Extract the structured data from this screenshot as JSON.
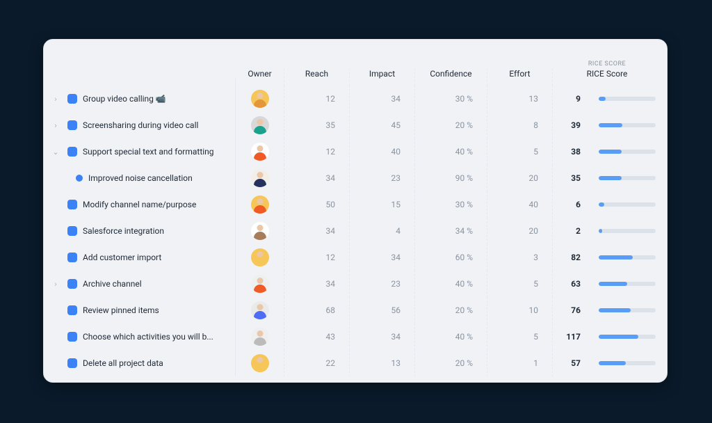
{
  "columns": {
    "score_pretitle": "RICE SCORE",
    "owner": "Owner",
    "reach": "Reach",
    "impact": "Impact",
    "confidence": "Confidence",
    "effort": "Effort",
    "score": "RICE Score"
  },
  "rows": [
    {
      "chevron": "right",
      "marker": "square",
      "title": "Group video calling 📹",
      "avatar": {
        "bg": "#f6c758",
        "accent": "#e4973a"
      },
      "reach": "12",
      "impact": "34",
      "confidence": "30 %",
      "effort": "13",
      "score": "9",
      "bar": 12
    },
    {
      "chevron": "right",
      "marker": "square",
      "title": "Screensharing during video call",
      "avatar": {
        "bg": "#d8d8d8",
        "accent": "#19a38f"
      },
      "reach": "35",
      "impact": "45",
      "confidence": "20 %",
      "effort": "8",
      "score": "39",
      "bar": 42
    },
    {
      "chevron": "down",
      "marker": "square",
      "title": "Support special text and formatting",
      "avatar": {
        "bg": "#ffffff",
        "accent": "#f05a24"
      },
      "reach": "12",
      "impact": "40",
      "confidence": "40 %",
      "effort": "5",
      "score": "38",
      "bar": 40
    },
    {
      "chevron": "none",
      "marker": "dot",
      "title": "Improved noise cancellation",
      "avatar": {
        "bg": "#f3efe8",
        "accent": "#27315e"
      },
      "reach": "34",
      "impact": "23",
      "confidence": "90 %",
      "effort": "20",
      "score": "35",
      "bar": 40,
      "child": true
    },
    {
      "chevron": "none",
      "marker": "square",
      "title": "Modify channel name/purpose",
      "avatar": {
        "bg": "#f6c758",
        "accent": "#f05a24"
      },
      "reach": "50",
      "impact": "15",
      "confidence": "30 %",
      "effort": "40",
      "score": "6",
      "bar": 10
    },
    {
      "chevron": "none",
      "marker": "square",
      "title": "Salesforce integration",
      "avatar": {
        "bg": "#ffffff",
        "accent": "#a77c5a"
      },
      "reach": "34",
      "impact": "4",
      "confidence": "34 %",
      "effort": "20",
      "score": "2",
      "bar": 6
    },
    {
      "chevron": "none",
      "marker": "square",
      "title": "Add customer import",
      "avatar": {
        "bg": "#f6c758",
        "accent": "#f6c758"
      },
      "reach": "12",
      "impact": "34",
      "confidence": "60 %",
      "effort": "3",
      "score": "82",
      "bar": 60
    },
    {
      "chevron": "right",
      "marker": "square",
      "title": "Archive channel",
      "avatar": {
        "bg": "#efefef",
        "accent": "#f05a24"
      },
      "reach": "34",
      "impact": "23",
      "confidence": "40 %",
      "effort": "5",
      "score": "63",
      "bar": 50
    },
    {
      "chevron": "none",
      "marker": "square",
      "title": "Review pinned items",
      "avatar": {
        "bg": "#eaeaea",
        "accent": "#4f6cf5"
      },
      "reach": "68",
      "impact": "56",
      "confidence": "20 %",
      "effort": "10",
      "score": "76",
      "bar": 56
    },
    {
      "chevron": "none",
      "marker": "square",
      "title": "Choose which activities you will b...",
      "avatar": {
        "bg": "#efefef",
        "accent": "#bbbbbb"
      },
      "reach": "43",
      "impact": "34",
      "confidence": "40 %",
      "effort": "5",
      "score": "117",
      "bar": 70
    },
    {
      "chevron": "none",
      "marker": "square",
      "title": "Delete all project data",
      "avatar": {
        "bg": "#f6c758",
        "accent": "#f6c758"
      },
      "reach": "22",
      "impact": "13",
      "confidence": "20 %",
      "effort": "1",
      "score": "57",
      "bar": 48
    }
  ]
}
